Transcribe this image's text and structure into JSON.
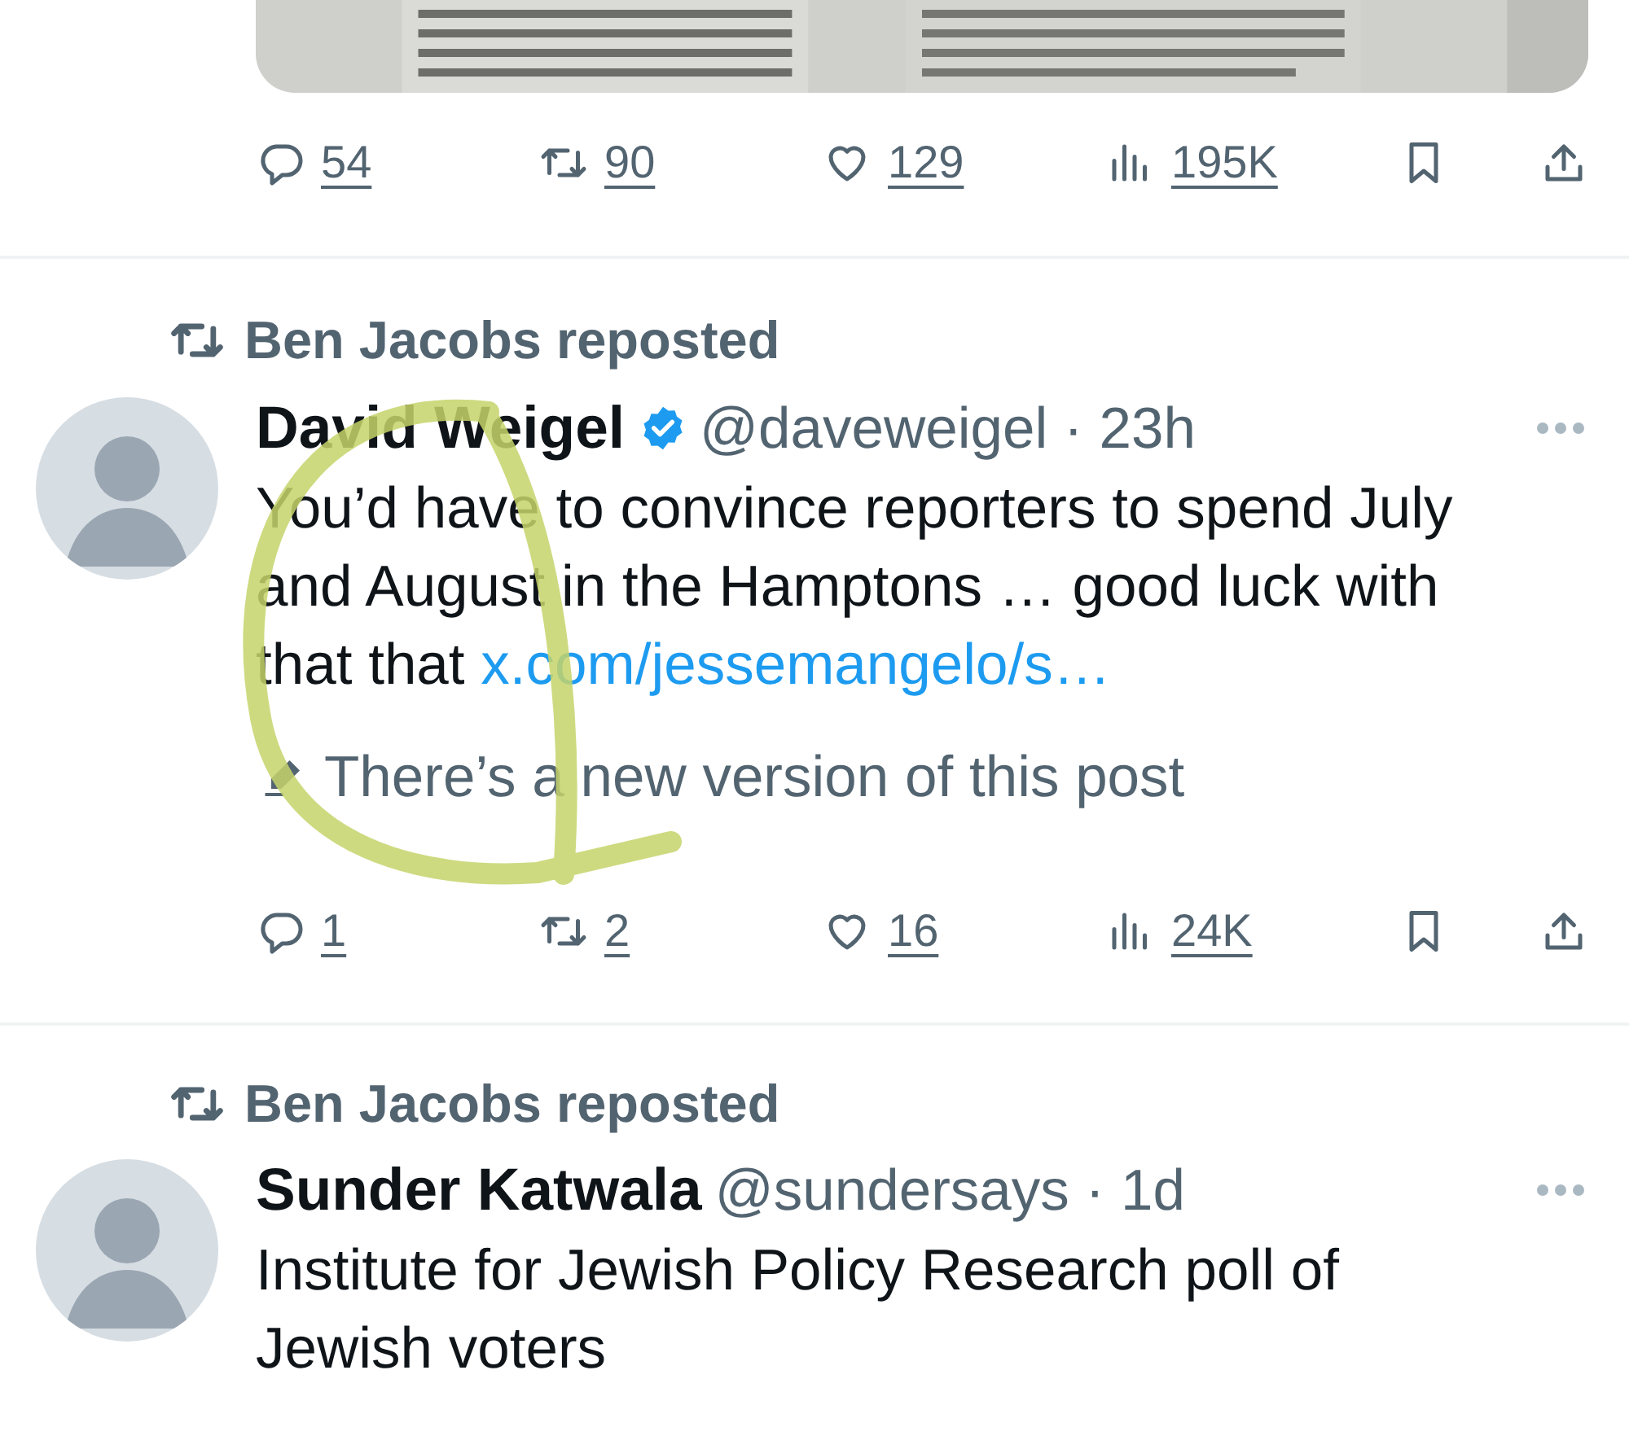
{
  "previous_post": {
    "actions": {
      "replies": "54",
      "reposts": "90",
      "likes": "129",
      "views": "195K"
    }
  },
  "posts": [
    {
      "repost_by": "Ben Jacobs reposted",
      "name": "David Weigel",
      "verified": true,
      "meta": "@daveweigel · 23h",
      "text": "You’d have to convince reporters to spend July and August in the Hamptons … good luck with that that ",
      "link": "x.com/jessemangelo/s…",
      "edit_notice": "There’s a new version of this post",
      "annotation": {
        "kind": "scribble"
      },
      "actions": {
        "replies": "1",
        "reposts": "2",
        "likes": "16",
        "views": "24K"
      }
    },
    {
      "repost_by": "Ben Jacobs reposted",
      "name": "Sunder Katwala",
      "verified": false,
      "meta": "@sundersays · 1d",
      "text": "Institute for Jewish Policy Research poll of Jewish voters"
    }
  ]
}
